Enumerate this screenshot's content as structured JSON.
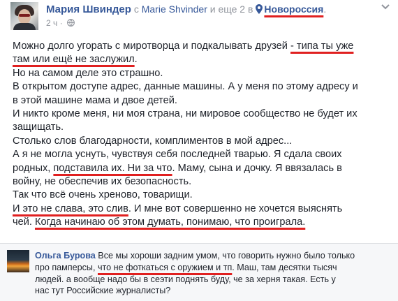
{
  "post": {
    "author": "Мария Швиндер",
    "with_word": "с",
    "tagged": "Marie Shvinder",
    "and_others": "и еще 2",
    "in_word": "в",
    "location": "Новороссия",
    "location_suffix": ".",
    "time": "2 ч",
    "time_sep": " · ",
    "icons": {
      "pin": "location-pin-icon",
      "privacy": "globe-icon",
      "menu": "chevron-down-icon"
    },
    "lines": [
      [
        {
          "t": "Можно долго угорать с миротворца и подкалывать друзей "
        },
        {
          "t": "- типа ты уже",
          "u": true
        }
      ],
      [
        {
          "t": "там или ещё не заслужил",
          "u": true
        },
        {
          "t": "."
        }
      ],
      [
        {
          "t": "Но на самом деле это страшно."
        }
      ],
      [
        {
          "t": "В открытом доступе адрес, данные машины. А у меня по этому адресу и"
        }
      ],
      [
        {
          "t": "в этой машине мама и двое детей."
        }
      ],
      [
        {
          "t": "И никто кроме меня, ни моя страна, ни мировое сообщество не будет их"
        }
      ],
      [
        {
          "t": "защищать."
        }
      ],
      [
        {
          "t": "Столько слов благодарности, комплиментов в мой адрес..."
        }
      ],
      [
        {
          "t": "А я не могла уснуть, чувствуя себя последней тварью. Я сдала своих"
        }
      ],
      [
        {
          "t": "родных, "
        },
        {
          "t": "подставила их. Ни за что",
          "u": true
        },
        {
          "t": ". Маму, сына и дочку. Я ввязалась в"
        }
      ],
      [
        {
          "t": "войну, не обеспечив их безопасность."
        }
      ],
      [
        {
          "t": "Так что всё очень хреново, товарищи."
        }
      ],
      [
        {
          "t": "И это не слава, это слив",
          "u": true
        },
        {
          "t": ". И мне вот совершенно не хочется выяснять"
        }
      ],
      [
        {
          "t": "чей. "
        },
        {
          "t": "Когда начинаю об этом думать, понимаю, что проиграла.",
          "u": true
        }
      ]
    ]
  },
  "comment": {
    "author": "Ольга Бурова",
    "lines": [
      [
        {
          "t": " Все мы хороши задним умом, что говорить нужно было только"
        }
      ],
      [
        {
          "t": "про памперсы, "
        },
        {
          "t": "что не фоткаться с оружием и тп",
          "u": true
        },
        {
          "t": ". Маш, там десятки тысяч"
        }
      ],
      [
        {
          "t": "людей. а вообще надо бы в сеэти поднять буду, че за херня такая. Есть у"
        }
      ],
      [
        {
          "t": "нас тут Российские журналисты?"
        }
      ]
    ]
  },
  "colors": {
    "link": "#365899",
    "underline": "#e02020",
    "text": "#1d2129",
    "meta": "#90949c",
    "comment_bg": "#f6f7f9"
  }
}
